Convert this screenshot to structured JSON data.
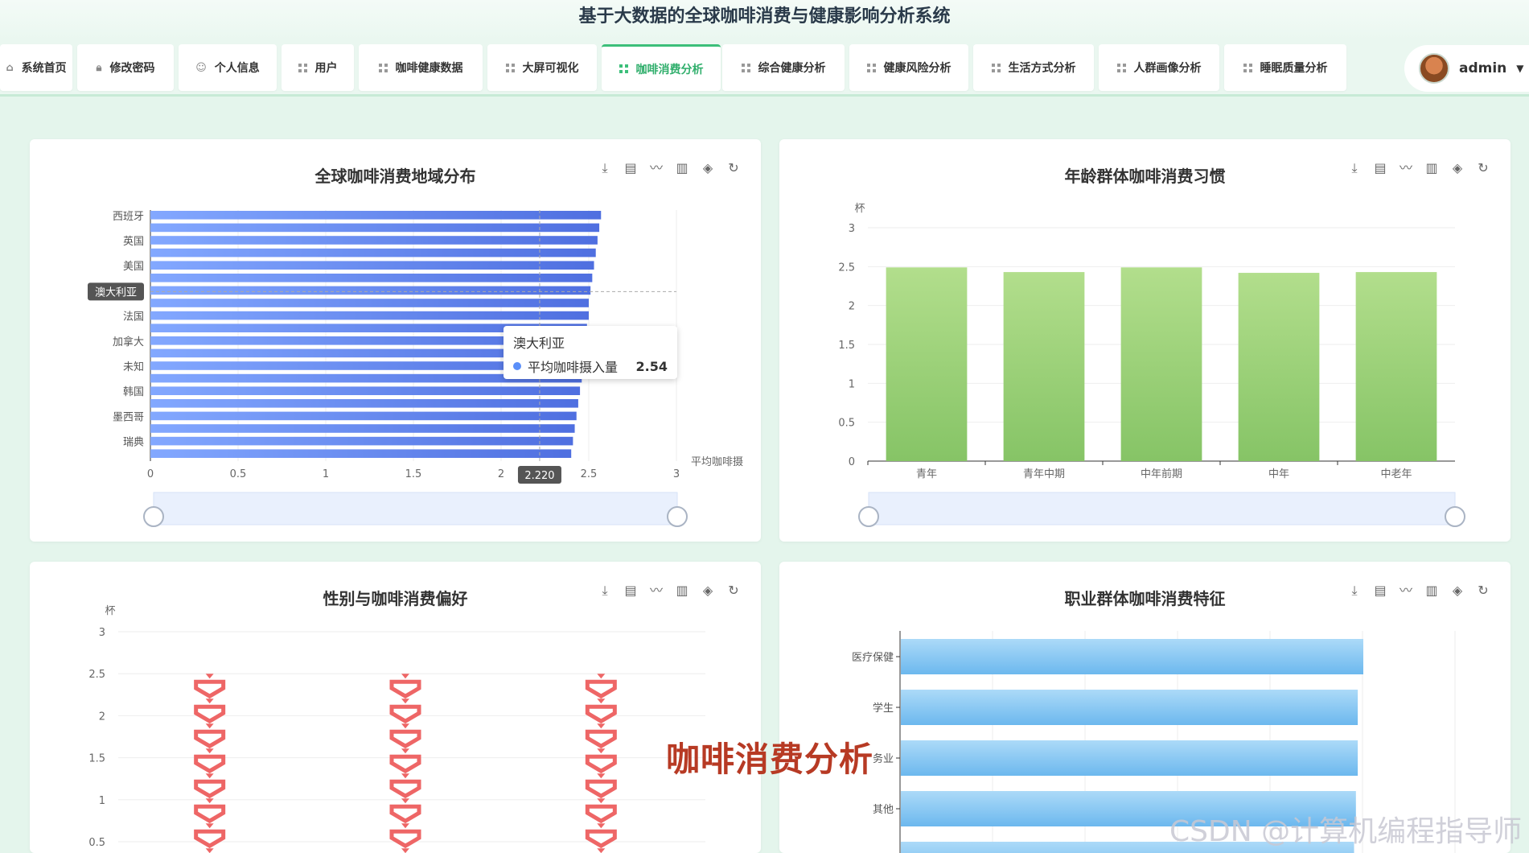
{
  "app_title": "基于大数据的全球咖啡消费与健康影响分析系统",
  "nav": [
    {
      "label": "系统首页",
      "icon": "home-icon"
    },
    {
      "label": "修改密码",
      "icon": "lock-icon"
    },
    {
      "label": "个人信息",
      "icon": "user-icon"
    },
    {
      "label": "用户",
      "icon": "grid-icon"
    },
    {
      "label": "咖啡健康数据",
      "icon": "grid-icon"
    },
    {
      "label": "大屏可视化",
      "icon": "grid-icon"
    },
    {
      "label": "咖啡消费分析",
      "icon": "grid-icon",
      "active": true
    },
    {
      "label": "综合健康分析",
      "icon": "grid-icon"
    },
    {
      "label": "健康风险分析",
      "icon": "grid-icon"
    },
    {
      "label": "生活方式分析",
      "icon": "grid-icon"
    },
    {
      "label": "人群画像分析",
      "icon": "grid-icon"
    },
    {
      "label": "睡眠质量分析",
      "icon": "grid-icon"
    }
  ],
  "user": {
    "name": "admin"
  },
  "toolbox_icons": [
    "download-icon",
    "data-view-icon",
    "line-chart-icon",
    "bar-chart-icon",
    "stack-icon",
    "refresh-icon"
  ],
  "overlay_caption": "咖啡消费分析",
  "watermark": "CSDN @计算机编程指导师",
  "colors": {
    "accent": "#3cbf7a",
    "bar_blue": "#5b8ff9",
    "bar_green": "#91cc75",
    "pictorial_red": "#ee6666",
    "bar_sky": "#7ec4f2"
  },
  "tooltip": {
    "title": "澳大利亚",
    "series": "平均咖啡摄入量",
    "value": "2.54"
  },
  "chart_data": [
    {
      "type": "bar",
      "orientation": "horizontal",
      "title": "全球咖啡消费地域分布",
      "xlabel": "平均咖啡摄",
      "xlim": [
        0,
        3
      ],
      "xticks": [
        "0",
        "0.5",
        "1",
        "1.5",
        "2",
        "2.5",
        "3"
      ],
      "y_tick_labels": [
        "西班牙",
        "英国",
        "美国",
        "澳大利亚",
        "法国",
        "加拿大",
        "未知",
        "韩国",
        "墨西哥",
        "瑞典"
      ],
      "axis_pointer": {
        "y_label": "澳大利亚",
        "x_label": "2.220"
      },
      "values": [
        2.57,
        2.56,
        2.55,
        2.54,
        2.53,
        2.52,
        2.51,
        2.5,
        2.5,
        2.49,
        2.49,
        2.48,
        2.47,
        2.46,
        2.45,
        2.44,
        2.43,
        2.42,
        2.41,
        2.4
      ],
      "grid": true,
      "datazoom": true
    },
    {
      "type": "bar",
      "title": "年龄群体咖啡消费习惯",
      "ylabel": "杯",
      "ylim": [
        0,
        3
      ],
      "yticks": [
        "0",
        "0.5",
        "1",
        "1.5",
        "2",
        "2.5",
        "3"
      ],
      "categories": [
        "青年",
        "青年中期",
        "中年前期",
        "中年",
        "中老年"
      ],
      "values": [
        2.49,
        2.43,
        2.49,
        2.42,
        2.43
      ],
      "grid": true,
      "datazoom": true
    },
    {
      "type": "bar",
      "subtype": "pictorial",
      "title": "性别与咖啡消费偏好",
      "ylabel": "杯",
      "ylim": [
        0.5,
        3
      ],
      "yticks": [
        "0.5",
        "1",
        "1.5",
        "2",
        "2.5",
        "3"
      ],
      "categories": [
        "",
        "",
        ""
      ],
      "values": [
        2.5,
        2.5,
        2.5
      ],
      "grid": true
    },
    {
      "type": "bar",
      "orientation": "horizontal",
      "title": "职业群体咖啡消费特征",
      "categories": [
        "医疗保健",
        "学生",
        "服务业",
        "其他"
      ],
      "category_labels_visible": [
        "医疗保健",
        "学生",
        "务业",
        "其他"
      ],
      "values": [
        2.5,
        2.47,
        2.47,
        2.46
      ],
      "xlim": [
        0,
        3
      ],
      "grid": true
    }
  ]
}
